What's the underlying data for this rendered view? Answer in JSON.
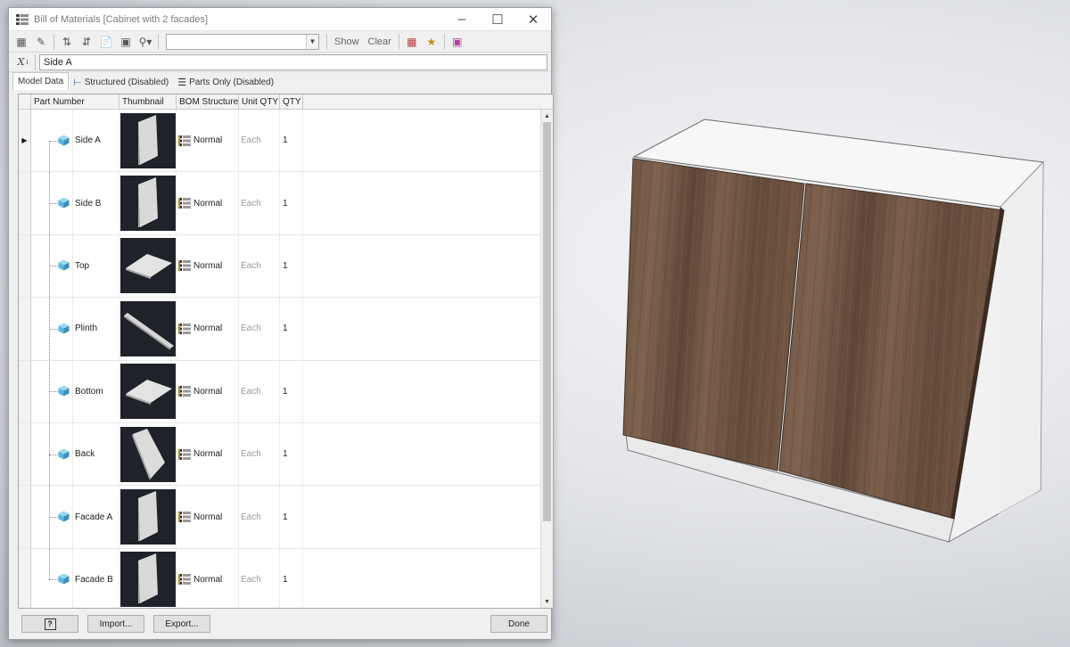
{
  "window": {
    "title": "Bill of Materials [Cabinet with 2 facades]",
    "minimize_icon": "minimize-icon",
    "maximize_icon": "maximize-icon",
    "close_icon": "close-icon"
  },
  "toolbar": {
    "show_label": "Show",
    "clear_label": "Clear",
    "filter_value": ""
  },
  "formula": {
    "fx_label": "X",
    "value": "Side A"
  },
  "tabs": [
    {
      "label": "Model Data",
      "active": true
    },
    {
      "label": "Structured (Disabled)",
      "active": false
    },
    {
      "label": "Parts Only (Disabled)",
      "active": false
    }
  ],
  "grid": {
    "columns": [
      "Part Number",
      "Thumbnail",
      "BOM Structure",
      "Unit QTY",
      "QTY"
    ],
    "rows": [
      {
        "part": "Side A",
        "bom": "Normal",
        "unit": "Each",
        "qty": "1",
        "shape": "vertical-panel"
      },
      {
        "part": "Side B",
        "bom": "Normal",
        "unit": "Each",
        "qty": "1",
        "shape": "vertical-panel"
      },
      {
        "part": "Top",
        "bom": "Normal",
        "unit": "Each",
        "qty": "1",
        "shape": "flat-panel"
      },
      {
        "part": "Plinth",
        "bom": "Normal",
        "unit": "Each",
        "qty": "1",
        "shape": "strip"
      },
      {
        "part": "Bottom",
        "bom": "Normal",
        "unit": "Each",
        "qty": "1",
        "shape": "flat-panel"
      },
      {
        "part": "Back",
        "bom": "Normal",
        "unit": "Each",
        "qty": "1",
        "shape": "back-panel"
      },
      {
        "part": "Facade A",
        "bom": "Normal",
        "unit": "Each",
        "qty": "1",
        "shape": "vertical-panel"
      },
      {
        "part": "Facade B",
        "bom": "Normal",
        "unit": "Each",
        "qty": "1",
        "shape": "vertical-panel"
      }
    ]
  },
  "footer": {
    "help_label": "?",
    "import_label": "Import...",
    "export_label": "Export...",
    "done_label": "Done"
  },
  "colors": {
    "wood": "#6f5542",
    "cabinet_white": "#f4f4f4",
    "part_icon": "#5fb6dc",
    "thumb_bg": "#1f2329"
  }
}
